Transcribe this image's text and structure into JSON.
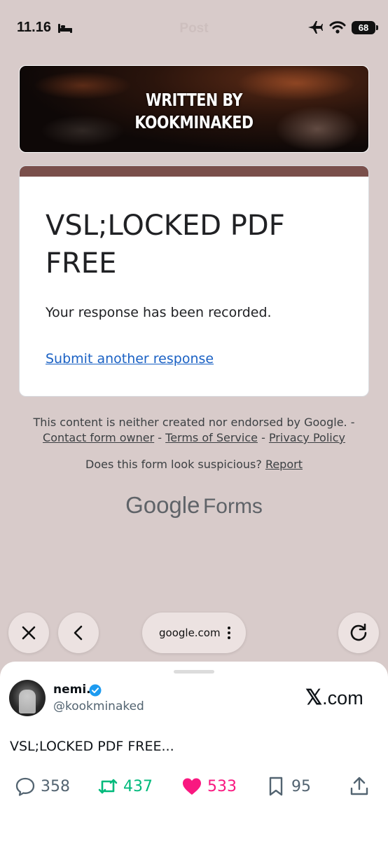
{
  "status_bar": {
    "time": "11.16",
    "title": "Post",
    "battery": "68"
  },
  "banner": {
    "line1": "WRITTEN BY",
    "line2": "KOOKMINAKED"
  },
  "form": {
    "title": "VSL;LOCKED PDF FREE",
    "message": "Your response has been recorded.",
    "link": "Submit another response",
    "accent_color": "#7a4f4b"
  },
  "footer": {
    "disclaimer": "This content is neither created nor endorsed by Google. -",
    "contact": "Contact form owner",
    "terms": "Terms of Service",
    "privacy": "Privacy Policy",
    "separator": " - ",
    "suspicious": "Does this form look suspicious?",
    "report": "Report",
    "brand_google": "Google",
    "brand_forms": "Forms"
  },
  "browser": {
    "url": "google.com",
    "close_icon": "close-icon",
    "back_icon": "back-chevron-icon",
    "reload_icon": "reload-icon"
  },
  "post": {
    "display_name": "nemi.",
    "handle": "@kookminaked",
    "source_x": "𝕏",
    "source_rest": ".com",
    "text": "VSL;LOCKED PDF FREE...",
    "replies": "358",
    "reposts": "437",
    "likes": "533",
    "bookmarks": "95"
  },
  "colors": {
    "background": "#d8cbca",
    "link": "#1a61c4",
    "repost": "#00ba7c",
    "like": "#f91880",
    "verified": "#1d9bf0"
  }
}
